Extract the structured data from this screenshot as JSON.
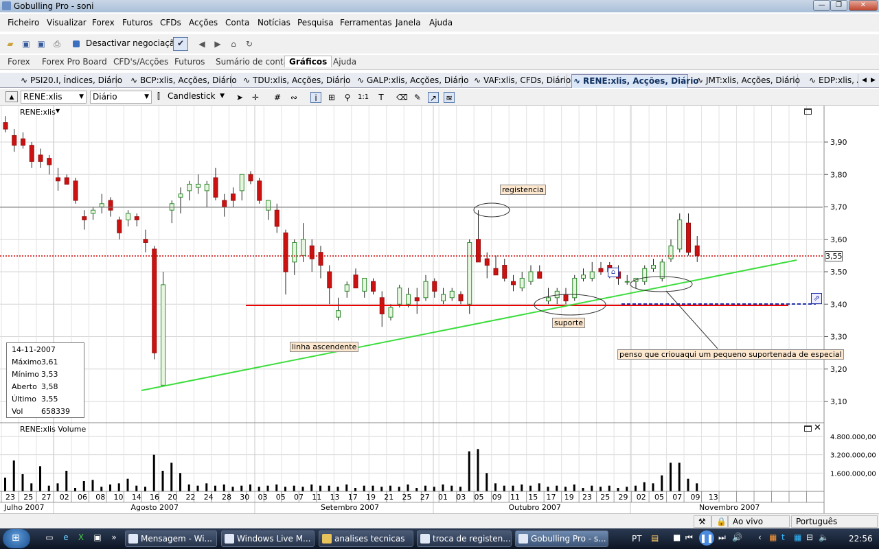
{
  "window": {
    "title": "Gobulling Pro - soni"
  },
  "menu": [
    "Ficheiro",
    "Visualizar",
    "Forex",
    "Futuros",
    "CFDs",
    "Acções",
    "Conta",
    "Notícias",
    "Pesquisa",
    "Ferramentas",
    "Janela",
    "Ajuda"
  ],
  "toolbar": {
    "trading_toggle_label": "Desactivar negociação"
  },
  "nav_tabs": [
    "Forex",
    "Forex Pro Board",
    "CFD's/Acções",
    "Futuros",
    "Sumário de conta",
    "Gráficos",
    "Ajuda"
  ],
  "nav_active": "Gráficos",
  "chart_tabs": [
    "PSI20.I, Índices, Diário",
    "BCP:xlis, Acções, Diário",
    "TDU:xlis, Acções, Diário",
    "GALP:xlis, Acções, Diário",
    "VAF:xlis, CFDs, Diário",
    "RENE:xlis, Acções, Diário",
    "JMT:xlis, Acções, Diário",
    "EDP:xlis, A"
  ],
  "chart_tabs_active": "RENE:xlis, Acções, Diário",
  "chart_toolbar": {
    "symbol": "RENE:xlis",
    "period": "Diário",
    "chart_type": "Candlestick"
  },
  "price_panel": {
    "label": "RENE:xlis",
    "last_price_label": "3,55"
  },
  "volume_panel": {
    "label": "RENE:xlis Volume"
  },
  "info_box": {
    "date": "14-11-2007",
    "rows": [
      {
        "k": "Máximo",
        "v": "3,61"
      },
      {
        "k": "Mínimo",
        "v": "3,53"
      },
      {
        "k": "Aberto",
        "v": "3,58"
      },
      {
        "k": "Último",
        "v": "3,55"
      },
      {
        "k": "Vol",
        "v": "658339"
      }
    ]
  },
  "annotations": {
    "registencia": "registencia",
    "suporte": "suporte",
    "linha": "linha ascendente",
    "comment": "penso que criouaqui um pequeno suportenada de especial"
  },
  "status": {
    "mode": "Ao vivo",
    "language": "Português"
  },
  "taskbar": {
    "items": [
      "Mensagem - Wi...",
      "Windows Live M...",
      "analises tecnicas",
      "troca de registen...",
      "Gobulling Pro - s..."
    ],
    "active": "Gobulling Pro - s...",
    "lang": "PT",
    "clock": "22:56"
  },
  "chart_data": [
    {
      "type": "candlestick",
      "title": "RENE:xlis",
      "ylim": [
        3.06,
        3.97
      ],
      "y_ticks": [
        "3,90",
        "3,80",
        "3,70",
        "3,60",
        "3,50",
        "3,40",
        "3,30",
        "3,20",
        "3,10"
      ],
      "day_ticks": [
        "23",
        "25",
        "27",
        "02",
        "06",
        "08",
        "10",
        "14",
        "16",
        "20",
        "22",
        "24",
        "28",
        "30",
        "03",
        "05",
        "07",
        "11",
        "13",
        "17",
        "19",
        "21",
        "25",
        "27",
        "01",
        "03",
        "05",
        "09",
        "11",
        "15",
        "17",
        "19",
        "23",
        "25",
        "29",
        "02",
        "05",
        "07",
        "09",
        "13"
      ],
      "month_labels": [
        "Julho 2007",
        "Agosto 2007",
        "Setembro 2007",
        "Outubro 2007",
        "Novembro 2007"
      ],
      "candles": [
        {
          "o": 3.96,
          "h": 3.98,
          "l": 3.93,
          "c": 3.94
        },
        {
          "o": 3.92,
          "h": 3.94,
          "l": 3.87,
          "c": 3.89
        },
        {
          "o": 3.91,
          "h": 3.93,
          "l": 3.88,
          "c": 3.89
        },
        {
          "o": 3.89,
          "h": 3.9,
          "l": 3.82,
          "c": 3.84
        },
        {
          "o": 3.86,
          "h": 3.88,
          "l": 3.82,
          "c": 3.84
        },
        {
          "o": 3.85,
          "h": 3.86,
          "l": 3.8,
          "c": 3.83
        },
        {
          "o": 3.79,
          "h": 3.82,
          "l": 3.75,
          "c": 3.78
        },
        {
          "o": 3.79,
          "h": 3.8,
          "l": 3.77,
          "c": 3.77
        },
        {
          "o": 3.78,
          "h": 3.79,
          "l": 3.71,
          "c": 3.72
        },
        {
          "o": 3.67,
          "h": 3.69,
          "l": 3.63,
          "c": 3.66
        },
        {
          "o": 3.68,
          "h": 3.7,
          "l": 3.66,
          "c": 3.69
        },
        {
          "o": 3.7,
          "h": 3.74,
          "l": 3.68,
          "c": 3.71
        },
        {
          "o": 3.72,
          "h": 3.73,
          "l": 3.67,
          "c": 3.69
        },
        {
          "o": 3.66,
          "h": 3.67,
          "l": 3.6,
          "c": 3.62
        },
        {
          "o": 3.66,
          "h": 3.69,
          "l": 3.64,
          "c": 3.68
        },
        {
          "o": 3.67,
          "h": 3.68,
          "l": 3.64,
          "c": 3.66
        },
        {
          "o": 3.6,
          "h": 3.63,
          "l": 3.56,
          "c": 3.59
        },
        {
          "o": 3.57,
          "h": 3.58,
          "l": 3.23,
          "c": 3.25
        },
        {
          "o": 3.15,
          "h": 3.5,
          "l": 3.15,
          "c": 3.46
        },
        {
          "o": 3.69,
          "h": 3.72,
          "l": 3.65,
          "c": 3.71
        },
        {
          "o": 3.73,
          "h": 3.76,
          "l": 3.68,
          "c": 3.74
        },
        {
          "o": 3.75,
          "h": 3.78,
          "l": 3.72,
          "c": 3.77
        },
        {
          "o": 3.76,
          "h": 3.8,
          "l": 3.74,
          "c": 3.77
        },
        {
          "o": 3.75,
          "h": 3.78,
          "l": 3.7,
          "c": 3.77
        },
        {
          "o": 3.79,
          "h": 3.82,
          "l": 3.72,
          "c": 3.73
        },
        {
          "o": 3.72,
          "h": 3.74,
          "l": 3.67,
          "c": 3.7
        },
        {
          "o": 3.74,
          "h": 3.76,
          "l": 3.7,
          "c": 3.72
        },
        {
          "o": 3.75,
          "h": 3.8,
          "l": 3.72,
          "c": 3.8
        },
        {
          "o": 3.8,
          "h": 3.81,
          "l": 3.77,
          "c": 3.78
        },
        {
          "o": 3.78,
          "h": 3.79,
          "l": 3.71,
          "c": 3.72
        },
        {
          "o": 3.69,
          "h": 3.71,
          "l": 3.66,
          "c": 3.72
        },
        {
          "o": 3.69,
          "h": 3.71,
          "l": 3.62,
          "c": 3.64
        },
        {
          "o": 3.62,
          "h": 3.63,
          "l": 3.43,
          "c": 3.5
        },
        {
          "o": 3.53,
          "h": 3.6,
          "l": 3.49,
          "c": 3.59
        },
        {
          "o": 3.55,
          "h": 3.65,
          "l": 3.53,
          "c": 3.6
        },
        {
          "o": 3.58,
          "h": 3.6,
          "l": 3.5,
          "c": 3.54
        },
        {
          "o": 3.56,
          "h": 3.58,
          "l": 3.48,
          "c": 3.52
        },
        {
          "o": 3.5,
          "h": 3.52,
          "l": 3.4,
          "c": 3.45
        },
        {
          "o": 3.36,
          "h": 3.42,
          "l": 3.35,
          "c": 3.38
        },
        {
          "o": 3.44,
          "h": 3.47,
          "l": 3.42,
          "c": 3.46
        },
        {
          "o": 3.49,
          "h": 3.51,
          "l": 3.45,
          "c": 3.45
        },
        {
          "o": 3.44,
          "h": 3.48,
          "l": 3.42,
          "c": 3.48
        },
        {
          "o": 3.47,
          "h": 3.48,
          "l": 3.43,
          "c": 3.44
        },
        {
          "o": 3.42,
          "h": 3.44,
          "l": 3.33,
          "c": 3.37
        },
        {
          "o": 3.36,
          "h": 3.4,
          "l": 3.35,
          "c": 3.39
        },
        {
          "o": 3.4,
          "h": 3.46,
          "l": 3.39,
          "c": 3.45
        },
        {
          "o": 3.4,
          "h": 3.45,
          "l": 3.39,
          "c": 3.43
        },
        {
          "o": 3.42,
          "h": 3.45,
          "l": 3.37,
          "c": 3.41
        },
        {
          "o": 3.42,
          "h": 3.49,
          "l": 3.41,
          "c": 3.47
        },
        {
          "o": 3.47,
          "h": 3.48,
          "l": 3.42,
          "c": 3.44
        },
        {
          "o": 3.41,
          "h": 3.45,
          "l": 3.4,
          "c": 3.43
        },
        {
          "o": 3.42,
          "h": 3.45,
          "l": 3.41,
          "c": 3.44
        },
        {
          "o": 3.43,
          "h": 3.44,
          "l": 3.4,
          "c": 3.41
        },
        {
          "o": 3.4,
          "h": 3.6,
          "l": 3.37,
          "c": 3.59
        },
        {
          "o": 3.6,
          "h": 3.69,
          "l": 3.53,
          "c": 3.53
        },
        {
          "o": 3.54,
          "h": 3.56,
          "l": 3.48,
          "c": 3.52
        },
        {
          "o": 3.51,
          "h": 3.55,
          "l": 3.49,
          "c": 3.49
        },
        {
          "o": 3.52,
          "h": 3.54,
          "l": 3.47,
          "c": 3.48
        },
        {
          "o": 3.47,
          "h": 3.49,
          "l": 3.44,
          "c": 3.46
        },
        {
          "o": 3.45,
          "h": 3.5,
          "l": 3.44,
          "c": 3.48
        },
        {
          "o": 3.47,
          "h": 3.52,
          "l": 3.46,
          "c": 3.5
        },
        {
          "o": 3.5,
          "h": 3.52,
          "l": 3.48,
          "c": 3.48
        },
        {
          "o": 3.41,
          "h": 3.45,
          "l": 3.4,
          "c": 3.42
        },
        {
          "o": 3.42,
          "h": 3.45,
          "l": 3.4,
          "c": 3.44
        },
        {
          "o": 3.43,
          "h": 3.45,
          "l": 3.4,
          "c": 3.41
        },
        {
          "o": 3.42,
          "h": 3.49,
          "l": 3.41,
          "c": 3.48
        },
        {
          "o": 3.48,
          "h": 3.51,
          "l": 3.47,
          "c": 3.49
        },
        {
          "o": 3.48,
          "h": 3.53,
          "l": 3.47,
          "c": 3.5
        },
        {
          "o": 3.51,
          "h": 3.53,
          "l": 3.49,
          "c": 3.5
        },
        {
          "o": 3.52,
          "h": 3.53,
          "l": 3.48,
          "c": 3.5
        },
        {
          "o": 3.5,
          "h": 3.52,
          "l": 3.46,
          "c": 3.48
        },
        {
          "o": 3.47,
          "h": 3.49,
          "l": 3.46,
          "c": 3.47
        },
        {
          "o": 3.47,
          "h": 3.48,
          "l": 3.45,
          "c": 3.48
        },
        {
          "o": 3.47,
          "h": 3.52,
          "l": 3.46,
          "c": 3.51
        },
        {
          "o": 3.51,
          "h": 3.54,
          "l": 3.5,
          "c": 3.52
        },
        {
          "o": 3.48,
          "h": 3.54,
          "l": 3.47,
          "c": 3.53
        },
        {
          "o": 3.54,
          "h": 3.6,
          "l": 3.53,
          "c": 3.58
        },
        {
          "o": 3.57,
          "h": 3.68,
          "l": 3.56,
          "c": 3.66
        },
        {
          "o": 3.65,
          "h": 3.68,
          "l": 3.55,
          "c": 3.56
        },
        {
          "o": 3.58,
          "h": 3.61,
          "l": 3.53,
          "c": 3.55
        }
      ]
    },
    {
      "type": "bar",
      "title": "RENE:xlis Volume",
      "ylim": [
        0,
        5200000
      ],
      "y_ticks": [
        "4.800.000,00",
        "3.200.000,00",
        "1.600.000,00"
      ],
      "values": [
        1200000,
        2700000,
        1500000,
        700000,
        2200000,
        500000,
        700000,
        1800000,
        300000,
        900000,
        1000000,
        400000,
        600000,
        700000,
        1100000,
        500000,
        400000,
        3200000,
        1800000,
        2500000,
        1600000,
        600000,
        500000,
        700000,
        500000,
        600000,
        400000,
        500000,
        600000,
        400000,
        500000,
        600000,
        400000,
        500000,
        400000,
        600000,
        500000,
        500000,
        400000,
        600000,
        300000,
        500000,
        500000,
        400000,
        500000,
        400000,
        600000,
        300000,
        500000,
        400000,
        600000,
        500000,
        400000,
        3500000,
        3700000,
        1600000,
        700000,
        500000,
        500000,
        600000,
        500000,
        700000,
        400000,
        500000,
        400000,
        600000,
        300000,
        500000,
        400000,
        500000,
        300000,
        400000,
        500000,
        800000,
        700000,
        1400000,
        2500000,
        2500000,
        1100000,
        700000
      ]
    }
  ]
}
